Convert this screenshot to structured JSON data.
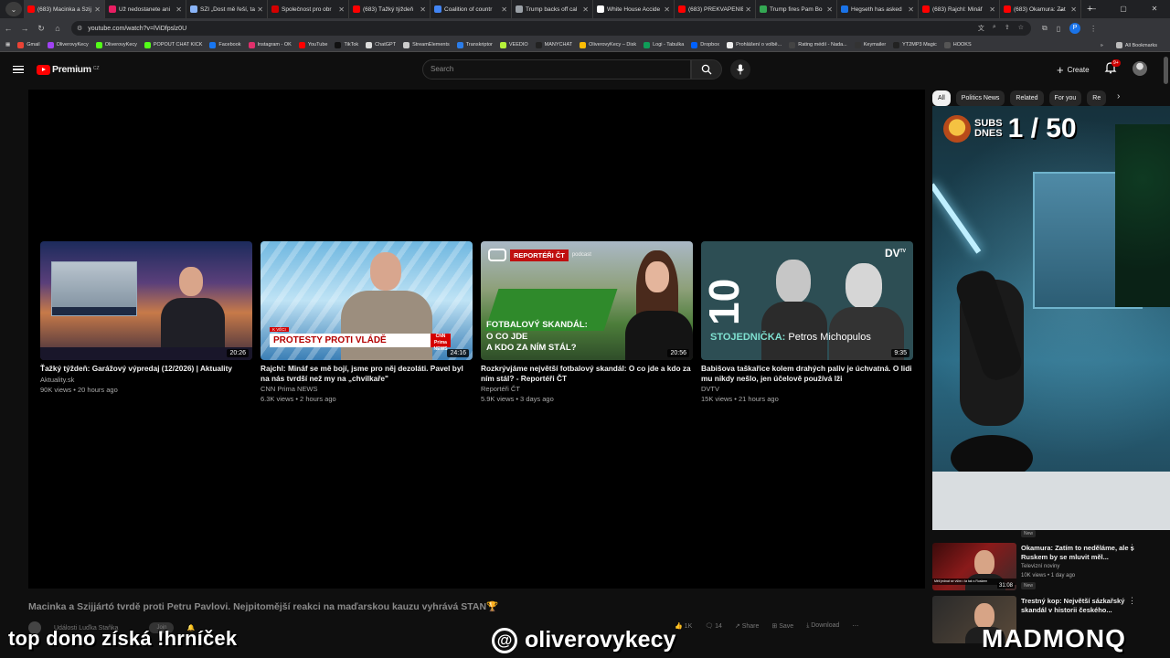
{
  "browser": {
    "tabs": [
      {
        "title": "(683) Macinka a Szij",
        "color": "#ff0000",
        "active": true
      },
      {
        "title": "Už nedostanete ani",
        "color": "#e91e63"
      },
      {
        "title": "SZI „Dost mě řeší, tak j",
        "color": "#8ab4f8"
      },
      {
        "title": "Společnost pro obr",
        "color": "#d40000"
      },
      {
        "title": "(683) Ťažký týždeň",
        "color": "#ff0000"
      },
      {
        "title": "Coalition of countr",
        "color": "#4285f4"
      },
      {
        "title": "Trump backs off cal",
        "color": "#9aa0a6"
      },
      {
        "title": "White House Accide",
        "color": "#ffffff"
      },
      {
        "title": "(683) PREKVAPENIE",
        "color": "#ff0000"
      },
      {
        "title": "Trump fires Pam Bo",
        "color": "#34a853"
      },
      {
        "title": "Hegseth has asked",
        "color": "#1a73e8"
      },
      {
        "title": "(683) Rajchl: Mináf",
        "color": "#ff0000"
      },
      {
        "title": "(683) Okamura: Zat",
        "color": "#ff0000"
      }
    ],
    "url": "youtube.com/watch?v=lViDfpslz0U",
    "bookmarks": [
      {
        "label": "Gmail",
        "color": "#ea4335"
      },
      {
        "label": "OliverovyKecy",
        "color": "#a142f4"
      },
      {
        "label": "OliverovyKecy",
        "color": "#53fc18"
      },
      {
        "label": "POPOUT CHAT KICK",
        "color": "#53fc18"
      },
      {
        "label": "Facebook",
        "color": "#1877f2"
      },
      {
        "label": "Instagram - OK",
        "color": "#e1306c"
      },
      {
        "label": "YouTube",
        "color": "#ff0000"
      },
      {
        "label": "TikTok",
        "color": "#111111"
      },
      {
        "label": "ChatGPT",
        "color": "#dddddd"
      },
      {
        "label": "StreamElements",
        "color": "#cccccc"
      },
      {
        "label": "Transkriptor",
        "color": "#2b7de9"
      },
      {
        "label": "VEEDIO",
        "color": "#b6f23a"
      },
      {
        "label": "MANYCHAT",
        "color": "#222222"
      },
      {
        "label": "OliverovyKecy – Disk",
        "color": "#fbbc04"
      },
      {
        "label": "Logi - Tabulka",
        "color": "#0f9d58"
      },
      {
        "label": "Dropbox",
        "color": "#0061ff"
      },
      {
        "label": "Prohlášení o volbě...",
        "color": "#eeeeee"
      },
      {
        "label": "Rating médií - Nada...",
        "color": "#444444"
      },
      {
        "label": "Keymailer",
        "color": "#333333"
      },
      {
        "label": "YT2MP3 Magic",
        "color": "#222222"
      },
      {
        "label": "HOOKS",
        "color": "#555555"
      }
    ],
    "all_bookmarks": "All Bookmarks",
    "profile_letter": "P"
  },
  "youtube": {
    "logo_text": "Premium",
    "country": "CZ",
    "search_placeholder": "Search",
    "create_label": "Create",
    "notif_count": "9+"
  },
  "endscreen": [
    {
      "title": "Ťažký týždeň: Garážový výpredaj (12/2026) | Aktuality",
      "channel": "Aktuality.sk",
      "meta": "90K views • 20 hours ago",
      "duration": "20:26"
    },
    {
      "title": "Rajchl: Mináf se mě bojí, jsme pro něj dezoláti. Pavel byl na nás tvrdší než my na „chvilkaře\"",
      "channel": "CNN Prima NEWS",
      "meta": "6.3K views • 2 hours ago",
      "duration": "24:16",
      "kicker": "K VĚCI",
      "lower": "PROTESTY PROTI VLÁDĚ",
      "brand": "CNN Prima NEWS"
    },
    {
      "title": "Rozkrývjáme největší fotbalový skandál: O co jde a kdo za ním stál? - Reportéři ČT",
      "channel": "Reportéři ČT",
      "meta": "5.9K views • 3 days ago",
      "duration": "20:56",
      "tag": "REPORTÉŘI ČT",
      "pod": "podcast",
      "headline": [
        "FOTBALOVÝ SKANDÁL:",
        "O CO JDE",
        "A KDO ZA NÍM STÁL?"
      ]
    },
    {
      "title": "Babišova taškařice kolem drahých paliv je úchvatná. O lidi mu nikdy nešlo, jen účelově používá lži",
      "channel": "DVTV",
      "meta": "15K views • 21 hours ago",
      "duration": "9:35",
      "num": "10",
      "brand": "DV",
      "brand_sup": "TV",
      "lower_a": "STOJEDNIČKA:",
      "lower_b": "Petros Michopulos"
    }
  ],
  "video": {
    "title": "Macinka a Szijjártó tvrdě proti Petru Pavlovi. Nejpitomější reakci na maďarskou kauzu vyhrává STAN🏆",
    "channel": "Události Luďka Staňka",
    "join": "Join",
    "likes": "1K",
    "comments": "14",
    "share": "Share",
    "save": "Save",
    "download": "Download"
  },
  "chips": [
    "All",
    "Politics News",
    "Related",
    "For you",
    "Re"
  ],
  "webcam": {
    "subs_label": [
      "SUBS",
      "DNES"
    ],
    "subs_count": "1 / 50"
  },
  "recommendations": [
    {
      "title": "Okamura: Zatím to neděláme, ale s Ruskem by se mluvit měl...",
      "channel": "Televizní noviny",
      "meta": "10K views • 1 day ago",
      "badge": "New",
      "duration": "31:08",
      "bar": "Měli jednat se vším • ta tak s Ruskem"
    },
    {
      "title": "Trestný kop: Největší sázkařský skandál v historii českého...",
      "channel": "",
      "meta": "",
      "badge": "",
      "duration": "",
      "bar": ""
    }
  ],
  "new_badge_top": "New",
  "overlay": {
    "left": "top dono získá !hrníček",
    "handle": "oliverovykecy",
    "right": "MADMONQ"
  }
}
